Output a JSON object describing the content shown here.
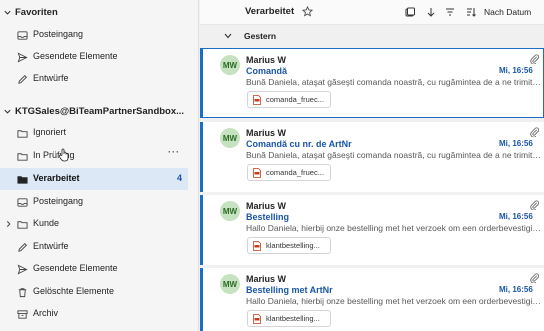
{
  "sidebar": {
    "favorites_header": "Favoriten",
    "favorites": [
      {
        "label": "Posteingang",
        "icon": "inbox-icon"
      },
      {
        "label": "Gesendete Elemente",
        "icon": "send-icon"
      },
      {
        "label": "Entwürfe",
        "icon": "pencil-icon"
      }
    ],
    "account_header": "KTGSales@BiTeamPartnerSandbox...",
    "folders": [
      {
        "label": "Ignoriert",
        "icon": "folder-icon"
      },
      {
        "label": "In Prüfung",
        "icon": "folder-icon",
        "more": "···"
      },
      {
        "label": "Verarbeitet",
        "icon": "folder-icon",
        "count": "4",
        "selected": true
      },
      {
        "label": "Posteingang",
        "icon": "inbox-icon"
      },
      {
        "label": "Kunde",
        "icon": "folder-icon"
      },
      {
        "label": "Entwürfe",
        "icon": "pencil-icon"
      },
      {
        "label": "Gesendete Elemente",
        "icon": "send-icon"
      },
      {
        "label": "Gelöschte Elemente",
        "icon": "trash-icon"
      },
      {
        "label": "Archiv",
        "icon": "archive-icon"
      }
    ]
  },
  "pane": {
    "title": "Verarbeitet",
    "sort_label": "Nach Datum",
    "group_label": "Gestern"
  },
  "messages": [
    {
      "initials": "MW",
      "sender": "Marius W",
      "subject": "Comandă",
      "time": "Mi, 16:56",
      "preview": "Bună Daniela, ataşat găseşti comanda noastră, cu rugămintea de a ne trimite confirmarea.",
      "attachment": "comanda_fruec..."
    },
    {
      "initials": "MW",
      "sender": "Marius W",
      "subject": "Comandă cu nr. de ArtNr",
      "time": "Mi, 16:56",
      "preview": "Bună Daniela, ataşat găseşti comanda noastră, cu rugămintea de a ne trimite confirmarea.",
      "attachment": "comanda_fruec..."
    },
    {
      "initials": "MW",
      "sender": "Marius W",
      "subject": "Bestelling",
      "time": "Mi, 16:56",
      "preview": "Hallo Daniela, hierbij onze bestelling met het verzoek om een orderbevestiging.",
      "attachment": "klantbestelling..."
    },
    {
      "initials": "MW",
      "sender": "Marius W",
      "subject": "Bestelling met ArtNr",
      "time": "Mi, 16:56",
      "preview": "Hallo Daniela, hierbij onze bestelling met het verzoek om een orderbevestiging.",
      "attachment": "klantbestelling..."
    }
  ],
  "colors": {
    "accent": "#1a6ec9",
    "link_text": "#1a56a6",
    "selected_folder_bg": "#dce8f6",
    "avatar_bg": "#c6e2c0",
    "avatar_text": "#2d6b28"
  }
}
